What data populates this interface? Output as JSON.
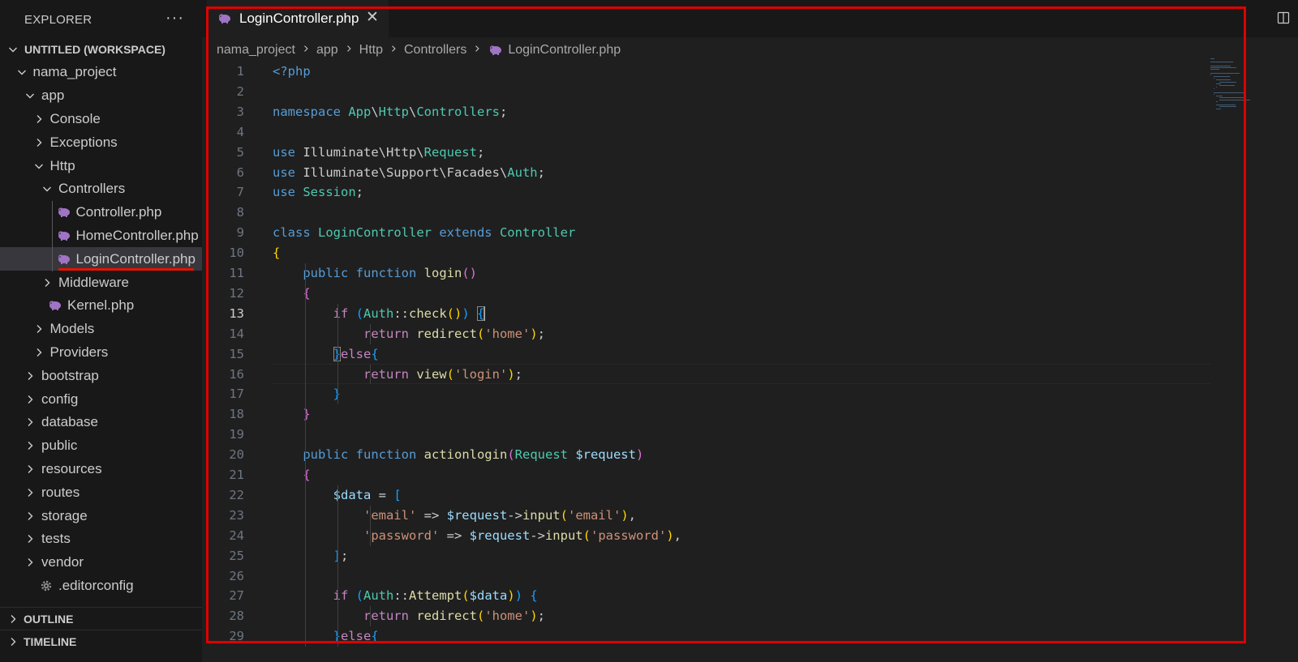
{
  "explorer": {
    "title": "EXPLORER",
    "more_label": "···",
    "items": [
      {
        "label": "UNTITLED (WORKSPACE)",
        "kind": "workspace",
        "depth": 0,
        "expanded": true
      },
      {
        "label": "nama_project",
        "kind": "folder",
        "depth": 1,
        "expanded": true
      },
      {
        "label": "app",
        "kind": "folder",
        "depth": 2,
        "expanded": true
      },
      {
        "label": "Console",
        "kind": "folder",
        "depth": 3,
        "expanded": false
      },
      {
        "label": "Exceptions",
        "kind": "folder",
        "depth": 3,
        "expanded": false
      },
      {
        "label": "Http",
        "kind": "folder",
        "depth": 3,
        "expanded": true
      },
      {
        "label": "Controllers",
        "kind": "folder",
        "depth": 4,
        "expanded": true
      },
      {
        "label": "Controller.php",
        "kind": "php",
        "depth": 5
      },
      {
        "label": "HomeController.php",
        "kind": "php",
        "depth": 5
      },
      {
        "label": "LoginController.php",
        "kind": "php",
        "depth": 5,
        "selected": true
      },
      {
        "label": "Middleware",
        "kind": "folder",
        "depth": 4,
        "expanded": false
      },
      {
        "label": "Kernel.php",
        "kind": "php",
        "depth": 4
      },
      {
        "label": "Models",
        "kind": "folder",
        "depth": 3,
        "expanded": false
      },
      {
        "label": "Providers",
        "kind": "folder",
        "depth": 3,
        "expanded": false
      },
      {
        "label": "bootstrap",
        "kind": "folder",
        "depth": 2,
        "expanded": false
      },
      {
        "label": "config",
        "kind": "folder",
        "depth": 2,
        "expanded": false
      },
      {
        "label": "database",
        "kind": "folder",
        "depth": 2,
        "expanded": false
      },
      {
        "label": "public",
        "kind": "folder",
        "depth": 2,
        "expanded": false
      },
      {
        "label": "resources",
        "kind": "folder",
        "depth": 2,
        "expanded": false
      },
      {
        "label": "routes",
        "kind": "folder",
        "depth": 2,
        "expanded": false
      },
      {
        "label": "storage",
        "kind": "folder",
        "depth": 2,
        "expanded": false
      },
      {
        "label": "tests",
        "kind": "folder",
        "depth": 2,
        "expanded": false
      },
      {
        "label": "vendor",
        "kind": "folder",
        "depth": 2,
        "expanded": false
      },
      {
        "label": ".editorconfig",
        "kind": "config",
        "depth": 2
      }
    ],
    "sections": [
      {
        "label": "OUTLINE"
      },
      {
        "label": "TIMELINE"
      }
    ]
  },
  "editor": {
    "tab": {
      "label": "LoginController.php",
      "close_glyph": "✕"
    },
    "breadcrumb": [
      "nama_project",
      "app",
      "Http",
      "Controllers",
      "LoginController.php"
    ],
    "active_line": 13,
    "lines": [
      {
        "n": "1",
        "t": [
          [
            "<?php",
            "kw"
          ]
        ]
      },
      {
        "n": "2",
        "t": []
      },
      {
        "n": "3",
        "t": [
          [
            "namespace ",
            "kw"
          ],
          [
            "App",
            "cls"
          ],
          [
            "\\",
            "pl"
          ],
          [
            "Http",
            "cls"
          ],
          [
            "\\",
            "pl"
          ],
          [
            "Controllers",
            "cls"
          ],
          [
            ";",
            "pl"
          ]
        ]
      },
      {
        "n": "4",
        "t": []
      },
      {
        "n": "5",
        "t": [
          [
            "use ",
            "kw"
          ],
          [
            "Illuminate\\Http\\",
            "pl"
          ],
          [
            "Request",
            "cls"
          ],
          [
            ";",
            "pl"
          ]
        ]
      },
      {
        "n": "6",
        "t": [
          [
            "use ",
            "kw"
          ],
          [
            "Illuminate\\Support\\Facades\\",
            "pl"
          ],
          [
            "Auth",
            "cls"
          ],
          [
            ";",
            "pl"
          ]
        ]
      },
      {
        "n": "7",
        "t": [
          [
            "use ",
            "kw"
          ],
          [
            "Session",
            "cls"
          ],
          [
            ";",
            "pl"
          ]
        ]
      },
      {
        "n": "8",
        "t": []
      },
      {
        "n": "9",
        "t": [
          [
            "class ",
            "kw"
          ],
          [
            "LoginController ",
            "cls"
          ],
          [
            "extends ",
            "kw"
          ],
          [
            "Controller",
            "cls"
          ]
        ]
      },
      {
        "n": "10",
        "t": [
          [
            "{",
            "b1"
          ]
        ]
      },
      {
        "n": "11",
        "t": [
          [
            "    ",
            "pl"
          ],
          [
            "public ",
            "kw"
          ],
          [
            "function ",
            "kw"
          ],
          [
            "login",
            "fn"
          ],
          [
            "()",
            "b2"
          ]
        ]
      },
      {
        "n": "12",
        "t": [
          [
            "    ",
            "pl"
          ],
          [
            "{",
            "b2"
          ]
        ]
      },
      {
        "n": "13",
        "t": [
          [
            "        ",
            "pl"
          ],
          [
            "if ",
            "ctl"
          ],
          [
            "(",
            "b3"
          ],
          [
            "Auth",
            "cls"
          ],
          [
            "::",
            "pl"
          ],
          [
            "check",
            "fn"
          ],
          [
            "()",
            "b1"
          ],
          [
            ")",
            "b3"
          ],
          [
            " ",
            "pl"
          ],
          [
            "{",
            "b3 bm"
          ],
          [
            "",
            "caret"
          ]
        ]
      },
      {
        "n": "14",
        "t": [
          [
            "            ",
            "pl"
          ],
          [
            "return ",
            "ctl"
          ],
          [
            "redirect",
            "fn"
          ],
          [
            "(",
            "b1"
          ],
          [
            "'home'",
            "str"
          ],
          [
            ")",
            "b1"
          ],
          [
            ";",
            "pl"
          ]
        ]
      },
      {
        "n": "15",
        "t": [
          [
            "        ",
            "pl"
          ],
          [
            "}",
            "b3 bm"
          ],
          [
            "else",
            "ctl"
          ],
          [
            "{",
            "b3"
          ]
        ]
      },
      {
        "n": "16",
        "t": [
          [
            "            ",
            "pl"
          ],
          [
            "return ",
            "ctl"
          ],
          [
            "view",
            "fn"
          ],
          [
            "(",
            "b1"
          ],
          [
            "'login'",
            "str"
          ],
          [
            ")",
            "b1"
          ],
          [
            ";",
            "pl"
          ]
        ]
      },
      {
        "n": "17",
        "t": [
          [
            "        ",
            "pl"
          ],
          [
            "}",
            "b3"
          ]
        ]
      },
      {
        "n": "18",
        "t": [
          [
            "    ",
            "pl"
          ],
          [
            "}",
            "b2"
          ]
        ]
      },
      {
        "n": "19",
        "t": []
      },
      {
        "n": "20",
        "t": [
          [
            "    ",
            "pl"
          ],
          [
            "public ",
            "kw"
          ],
          [
            "function ",
            "kw"
          ],
          [
            "actionlogin",
            "fn"
          ],
          [
            "(",
            "b2"
          ],
          [
            "Request ",
            "cls"
          ],
          [
            "$request",
            "var"
          ],
          [
            ")",
            "b2"
          ]
        ]
      },
      {
        "n": "21",
        "t": [
          [
            "    ",
            "pl"
          ],
          [
            "{",
            "b2"
          ]
        ]
      },
      {
        "n": "22",
        "t": [
          [
            "        ",
            "pl"
          ],
          [
            "$data",
            "var"
          ],
          [
            " = ",
            "pl"
          ],
          [
            "[",
            "b3"
          ]
        ]
      },
      {
        "n": "23",
        "t": [
          [
            "            ",
            "pl"
          ],
          [
            "'email'",
            "str"
          ],
          [
            " => ",
            "pl"
          ],
          [
            "$request",
            "var"
          ],
          [
            "->",
            "pl"
          ],
          [
            "input",
            "fn"
          ],
          [
            "(",
            "b1"
          ],
          [
            "'email'",
            "str"
          ],
          [
            ")",
            "b1"
          ],
          [
            ",",
            "pl"
          ]
        ]
      },
      {
        "n": "24",
        "t": [
          [
            "            ",
            "pl"
          ],
          [
            "'password'",
            "str"
          ],
          [
            " => ",
            "pl"
          ],
          [
            "$request",
            "var"
          ],
          [
            "->",
            "pl"
          ],
          [
            "input",
            "fn"
          ],
          [
            "(",
            "b1"
          ],
          [
            "'password'",
            "str"
          ],
          [
            ")",
            "b1"
          ],
          [
            ",",
            "pl"
          ]
        ]
      },
      {
        "n": "25",
        "t": [
          [
            "        ",
            "pl"
          ],
          [
            "]",
            "b3"
          ],
          [
            ";",
            "pl"
          ]
        ]
      },
      {
        "n": "26",
        "t": []
      },
      {
        "n": "27",
        "t": [
          [
            "        ",
            "pl"
          ],
          [
            "if ",
            "ctl"
          ],
          [
            "(",
            "b3"
          ],
          [
            "Auth",
            "cls"
          ],
          [
            "::",
            "pl"
          ],
          [
            "Attempt",
            "fn"
          ],
          [
            "(",
            "b1"
          ],
          [
            "$data",
            "var"
          ],
          [
            ")",
            "b1"
          ],
          [
            ")",
            "b3"
          ],
          [
            " ",
            "pl"
          ],
          [
            "{",
            "b3"
          ]
        ]
      },
      {
        "n": "28",
        "t": [
          [
            "            ",
            "pl"
          ],
          [
            "return ",
            "ctl"
          ],
          [
            "redirect",
            "fn"
          ],
          [
            "(",
            "b1"
          ],
          [
            "'home'",
            "str"
          ],
          [
            ")",
            "b1"
          ],
          [
            ";",
            "pl"
          ]
        ]
      },
      {
        "n": "29",
        "t": [
          [
            "        ",
            "pl"
          ],
          [
            "}",
            "b3"
          ],
          [
            "else",
            "ctl"
          ],
          [
            "{",
            "b3"
          ]
        ]
      }
    ]
  }
}
